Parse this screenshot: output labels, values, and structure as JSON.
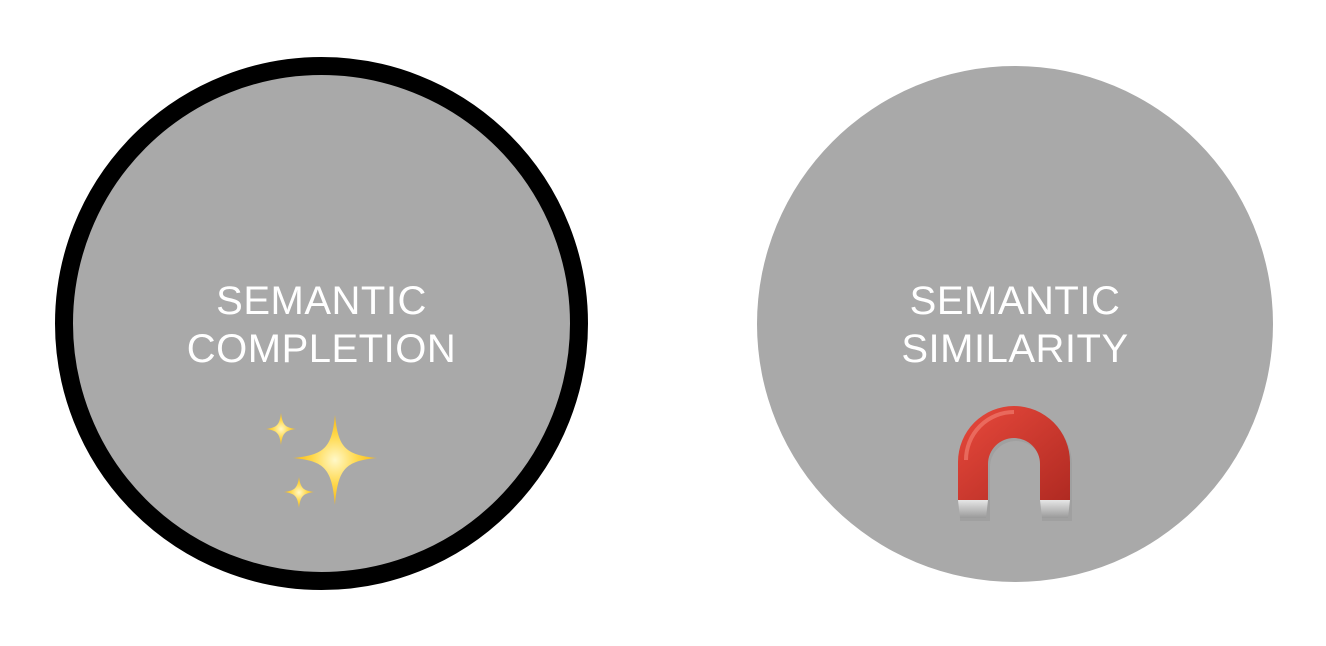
{
  "diagram": {
    "left_circle": {
      "line1": "SEMANTIC",
      "line2": "COMPLETION",
      "icon": "sparkles-icon",
      "fill": "#a9a9a9",
      "border": "#000000",
      "selected": true
    },
    "right_circle": {
      "line1": "SEMANTIC",
      "line2": "SIMILARITY",
      "icon": "magnet-icon",
      "fill": "#a9a9a9"
    }
  }
}
